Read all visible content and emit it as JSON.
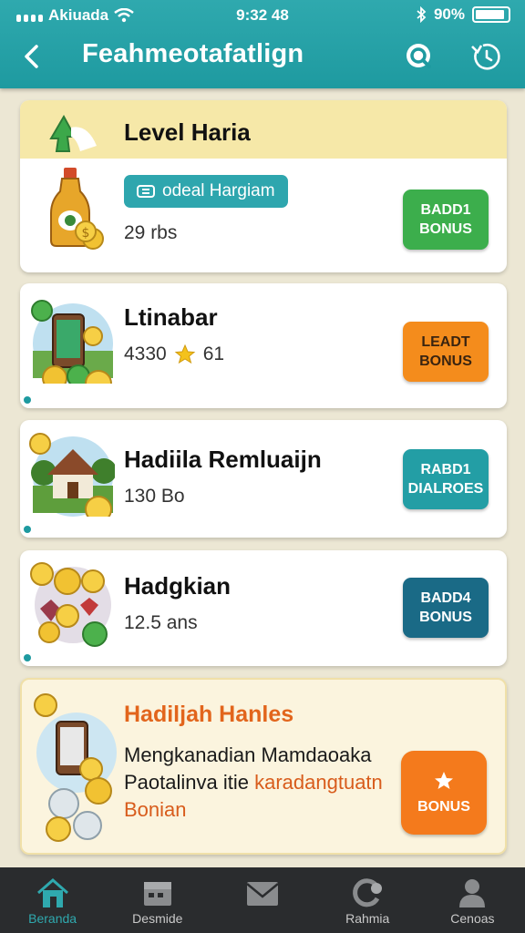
{
  "status_bar": {
    "carrier": "Akiuada",
    "time": "9:32 48",
    "battery": "90%",
    "icons": [
      "signal-icon",
      "wifi-icon",
      "bluetooth-icon",
      "battery-icon"
    ]
  },
  "header": {
    "title": "Feahmeotafatlign",
    "back_icon": "back-arrow-icon",
    "right_icons": [
      "search-icon",
      "timer-icon"
    ]
  },
  "cards": [
    {
      "title": "Level Haria",
      "tag": "odeal Hargiam",
      "subtitle": "29 rbs",
      "button": "BADD1 BONUS",
      "button_color": "#3cae4c",
      "thumb": "bottle-coins"
    },
    {
      "title": "Ltinabar",
      "subtitle_value": "4330",
      "subtitle_extra": "61",
      "button": "LEADT BONUS",
      "button_color": "#f48c1c",
      "thumb": "phone-coins"
    },
    {
      "title": "Hadiila Remluaijn",
      "subtitle": "130 Bo",
      "button": "RABD1 DIALROES",
      "button_color": "#239ea5",
      "thumb": "house"
    },
    {
      "title": "Hadgkian",
      "subtitle": "12.5 ans",
      "button": "BADD4 BONUS",
      "button_color": "#1a6a86",
      "thumb": "coins-gems"
    }
  ],
  "promo": {
    "title": "Hadiljah Hanles",
    "line1": "Mengkanadian Mamdaoaka",
    "line2_plain": "Paotalinva itie",
    "line2_highlight": "karadangtuatn",
    "line3": "Bonian",
    "button": "BONUS",
    "button_color": "#f47a1c"
  },
  "bottom_nav": [
    {
      "label": "Beranda",
      "icon": "home-icon",
      "active": true
    },
    {
      "label": "Desmide",
      "icon": "calendar-icon"
    },
    {
      "label": "",
      "icon": "mail-icon"
    },
    {
      "label": "Rahmia",
      "icon": "refresh-icon"
    },
    {
      "label": "Cenoas",
      "icon": "profile-icon"
    }
  ],
  "colors": {
    "header": "#1e9aa0",
    "background": "#ece7d4",
    "nav_bg": "#2a2c2e"
  }
}
